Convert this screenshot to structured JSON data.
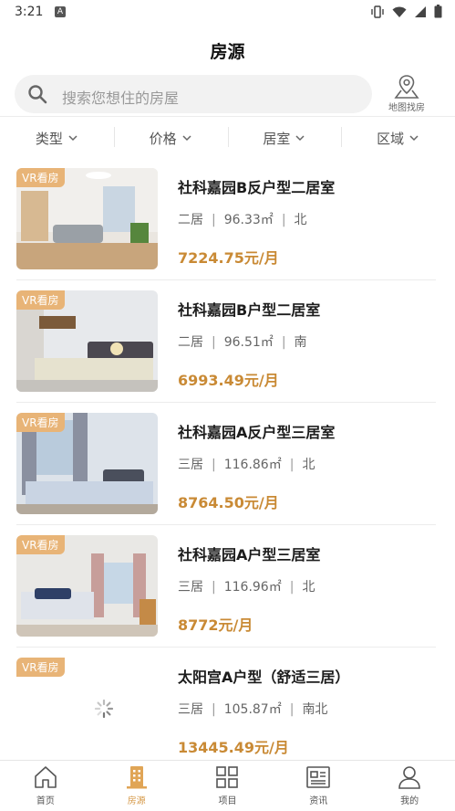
{
  "status_bar": {
    "time": "3:21",
    "notification_letter": "A"
  },
  "header": {
    "title": "房源"
  },
  "search": {
    "placeholder": "搜索您想住的房屋"
  },
  "map_button": {
    "label": "地图找房"
  },
  "filters": [
    {
      "label": "类型"
    },
    {
      "label": "价格"
    },
    {
      "label": "居室"
    },
    {
      "label": "区域"
    }
  ],
  "listings": [
    {
      "badge": "VR看房",
      "title": "社科嘉园B反户型二居室",
      "rooms": "二居",
      "area": "96.33㎡",
      "orientation": "北",
      "price": "7224.75元/月"
    },
    {
      "badge": "VR看房",
      "title": "社科嘉园B户型二居室",
      "rooms": "二居",
      "area": "96.51㎡",
      "orientation": "南",
      "price": "6993.49元/月"
    },
    {
      "badge": "VR看房",
      "title": "社科嘉园A反户型三居室",
      "rooms": "三居",
      "area": "116.86㎡",
      "orientation": "北",
      "price": "8764.50元/月"
    },
    {
      "badge": "VR看房",
      "title": "社科嘉园A户型三居室",
      "rooms": "三居",
      "area": "116.96㎡",
      "orientation": "北",
      "price": "8772元/月"
    },
    {
      "badge": "VR看房",
      "title": "太阳宫A户型（舒适三居）",
      "rooms": "三居",
      "area": "105.87㎡",
      "orientation": "南北",
      "price": "13445.49元/月"
    }
  ],
  "tabbar": [
    {
      "label": "首页",
      "icon": "home-icon"
    },
    {
      "label": "房源",
      "icon": "building-icon",
      "active": true
    },
    {
      "label": "项目",
      "icon": "grid-icon"
    },
    {
      "label": "资讯",
      "icon": "news-icon"
    },
    {
      "label": "我的",
      "icon": "user-icon"
    }
  ],
  "colors": {
    "accent": "#d69a4a",
    "price": "#c98a35",
    "badge": "#e8b477"
  }
}
